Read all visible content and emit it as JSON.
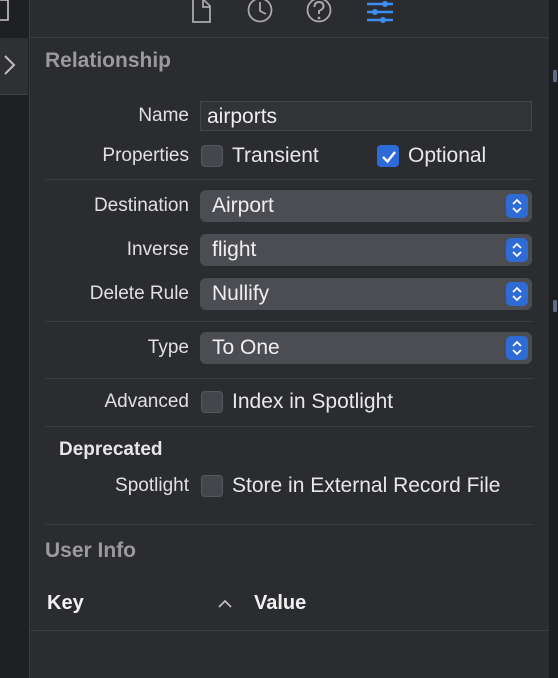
{
  "toolbar": {
    "icons": [
      "file-inspector-icon",
      "history-inspector-icon",
      "help-inspector-icon",
      "attributes-inspector-icon"
    ],
    "active_color": "#3c8ef0"
  },
  "relationship": {
    "title": "Relationship",
    "name_label": "Name",
    "name_value": "airports",
    "properties_label": "Properties",
    "transient_label": "Transient",
    "transient_checked": false,
    "optional_label": "Optional",
    "optional_checked": true,
    "destination_label": "Destination",
    "destination_value": "Airport",
    "inverse_label": "Inverse",
    "inverse_value": "flight",
    "delete_rule_label": "Delete Rule",
    "delete_rule_value": "Nullify",
    "type_label": "Type",
    "type_value": "To One",
    "advanced_label": "Advanced",
    "index_spotlight_label": "Index in Spotlight",
    "deprecated_label": "Deprecated",
    "spotlight_label": "Spotlight",
    "store_external_label": "Store in External Record File"
  },
  "user_info": {
    "title": "User Info",
    "key_header": "Key",
    "value_header": "Value"
  },
  "colors": {
    "panel_bg": "#2b2c30",
    "accent": "#2f6bd8"
  }
}
